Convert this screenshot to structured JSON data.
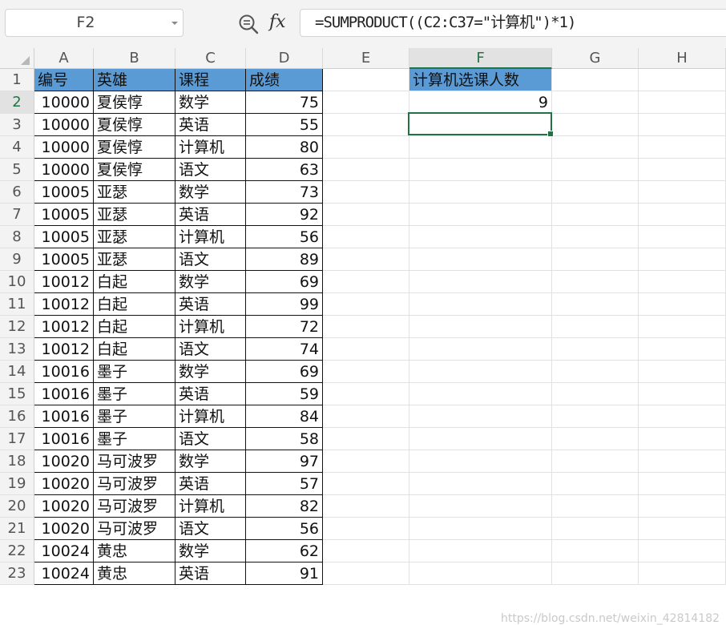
{
  "name_box": "F2",
  "formula": "=SUMPRODUCT((C2:C37=\"计算机\")*1)",
  "icons": {
    "zoom": "zoom-formula-icon",
    "fx": "fx"
  },
  "selected_cell": "F2",
  "columns": [
    "A",
    "B",
    "C",
    "D",
    "E",
    "F",
    "G",
    "H"
  ],
  "rows": [
    "1",
    "2",
    "3",
    "4",
    "5",
    "6",
    "7",
    "8",
    "9",
    "10",
    "11",
    "12",
    "13",
    "14",
    "15",
    "16",
    "17",
    "18",
    "19",
    "20",
    "21",
    "22",
    "23"
  ],
  "table_header": [
    "编号",
    "英雄",
    "课程",
    "成绩"
  ],
  "table_rows": [
    [
      "10000",
      "夏侯惇",
      "数学",
      "75"
    ],
    [
      "10000",
      "夏侯惇",
      "英语",
      "55"
    ],
    [
      "10000",
      "夏侯惇",
      "计算机",
      "80"
    ],
    [
      "10000",
      "夏侯惇",
      "语文",
      "63"
    ],
    [
      "10005",
      "亚瑟",
      "数学",
      "73"
    ],
    [
      "10005",
      "亚瑟",
      "英语",
      "92"
    ],
    [
      "10005",
      "亚瑟",
      "计算机",
      "56"
    ],
    [
      "10005",
      "亚瑟",
      "语文",
      "89"
    ],
    [
      "10012",
      "白起",
      "数学",
      "69"
    ],
    [
      "10012",
      "白起",
      "英语",
      "99"
    ],
    [
      "10012",
      "白起",
      "计算机",
      "72"
    ],
    [
      "10012",
      "白起",
      "语文",
      "74"
    ],
    [
      "10016",
      "墨子",
      "数学",
      "69"
    ],
    [
      "10016",
      "墨子",
      "英语",
      "59"
    ],
    [
      "10016",
      "墨子",
      "计算机",
      "84"
    ],
    [
      "10016",
      "墨子",
      "语文",
      "58"
    ],
    [
      "10020",
      "马可波罗",
      "数学",
      "97"
    ],
    [
      "10020",
      "马可波罗",
      "英语",
      "57"
    ],
    [
      "10020",
      "马可波罗",
      "计算机",
      "82"
    ],
    [
      "10020",
      "马可波罗",
      "语文",
      "56"
    ],
    [
      "10024",
      "黄忠",
      "数学",
      "62"
    ],
    [
      "10024",
      "黄忠",
      "英语",
      "91"
    ]
  ],
  "result_header": "计算机选课人数",
  "result_value": "9",
  "watermark": "https://blog.csdn.net/weixin_42814182",
  "colors": {
    "header_fill": "#5b9bd5",
    "selection": "#217346"
  }
}
